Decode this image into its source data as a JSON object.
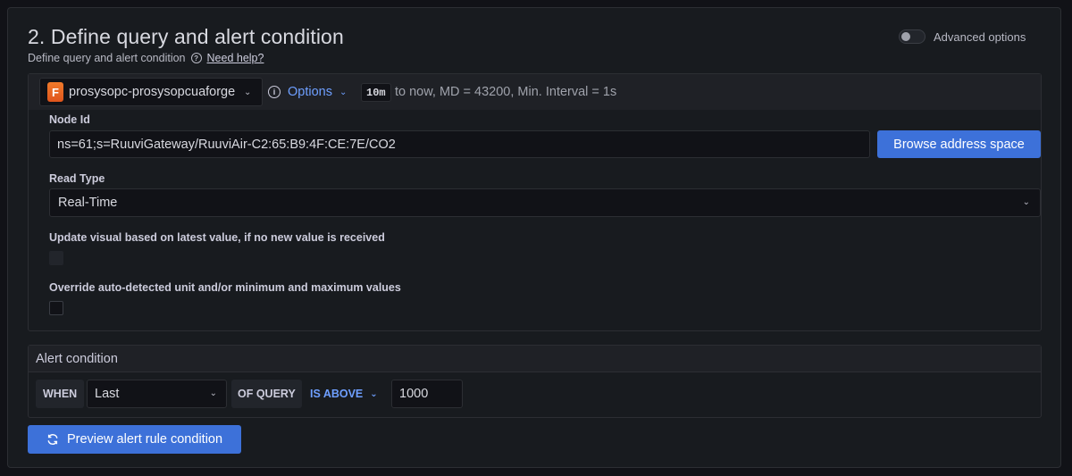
{
  "section": {
    "title": "2. Define query and alert condition",
    "subtitle": "Define query and alert condition",
    "help_link": "Need help?",
    "advanced_options_label": "Advanced options",
    "advanced_options_enabled": false
  },
  "query": {
    "datasource_name": "prosysopc-prosysopcuaforge",
    "options_label": "Options",
    "time_range": "10m",
    "time_info": "to now, MD = 43200, Min. Interval = 1s",
    "node_id_label": "Node Id",
    "node_id_value": "ns=61;s=RuuviGateway/RuuviAir-C2:65:B9:4F:CE:7E/CO2",
    "browse_button": "Browse address space",
    "read_type_label": "Read Type",
    "read_type_value": "Real-Time",
    "update_visual_label": "Update visual based on latest value, if no new value is received",
    "override_label": "Override auto-detected unit and/or minimum and maximum values"
  },
  "alert": {
    "header": "Alert condition",
    "when_label": "WHEN",
    "reducer_value": "Last",
    "of_query_label": "OF QUERY",
    "evaluator_value": "IS ABOVE",
    "threshold_value": "1000"
  },
  "actions": {
    "preview_button": "Preview alert rule condition"
  },
  "colors": {
    "accent": "#3d71d9",
    "link": "#6e9fff",
    "background": "#181b1f"
  }
}
